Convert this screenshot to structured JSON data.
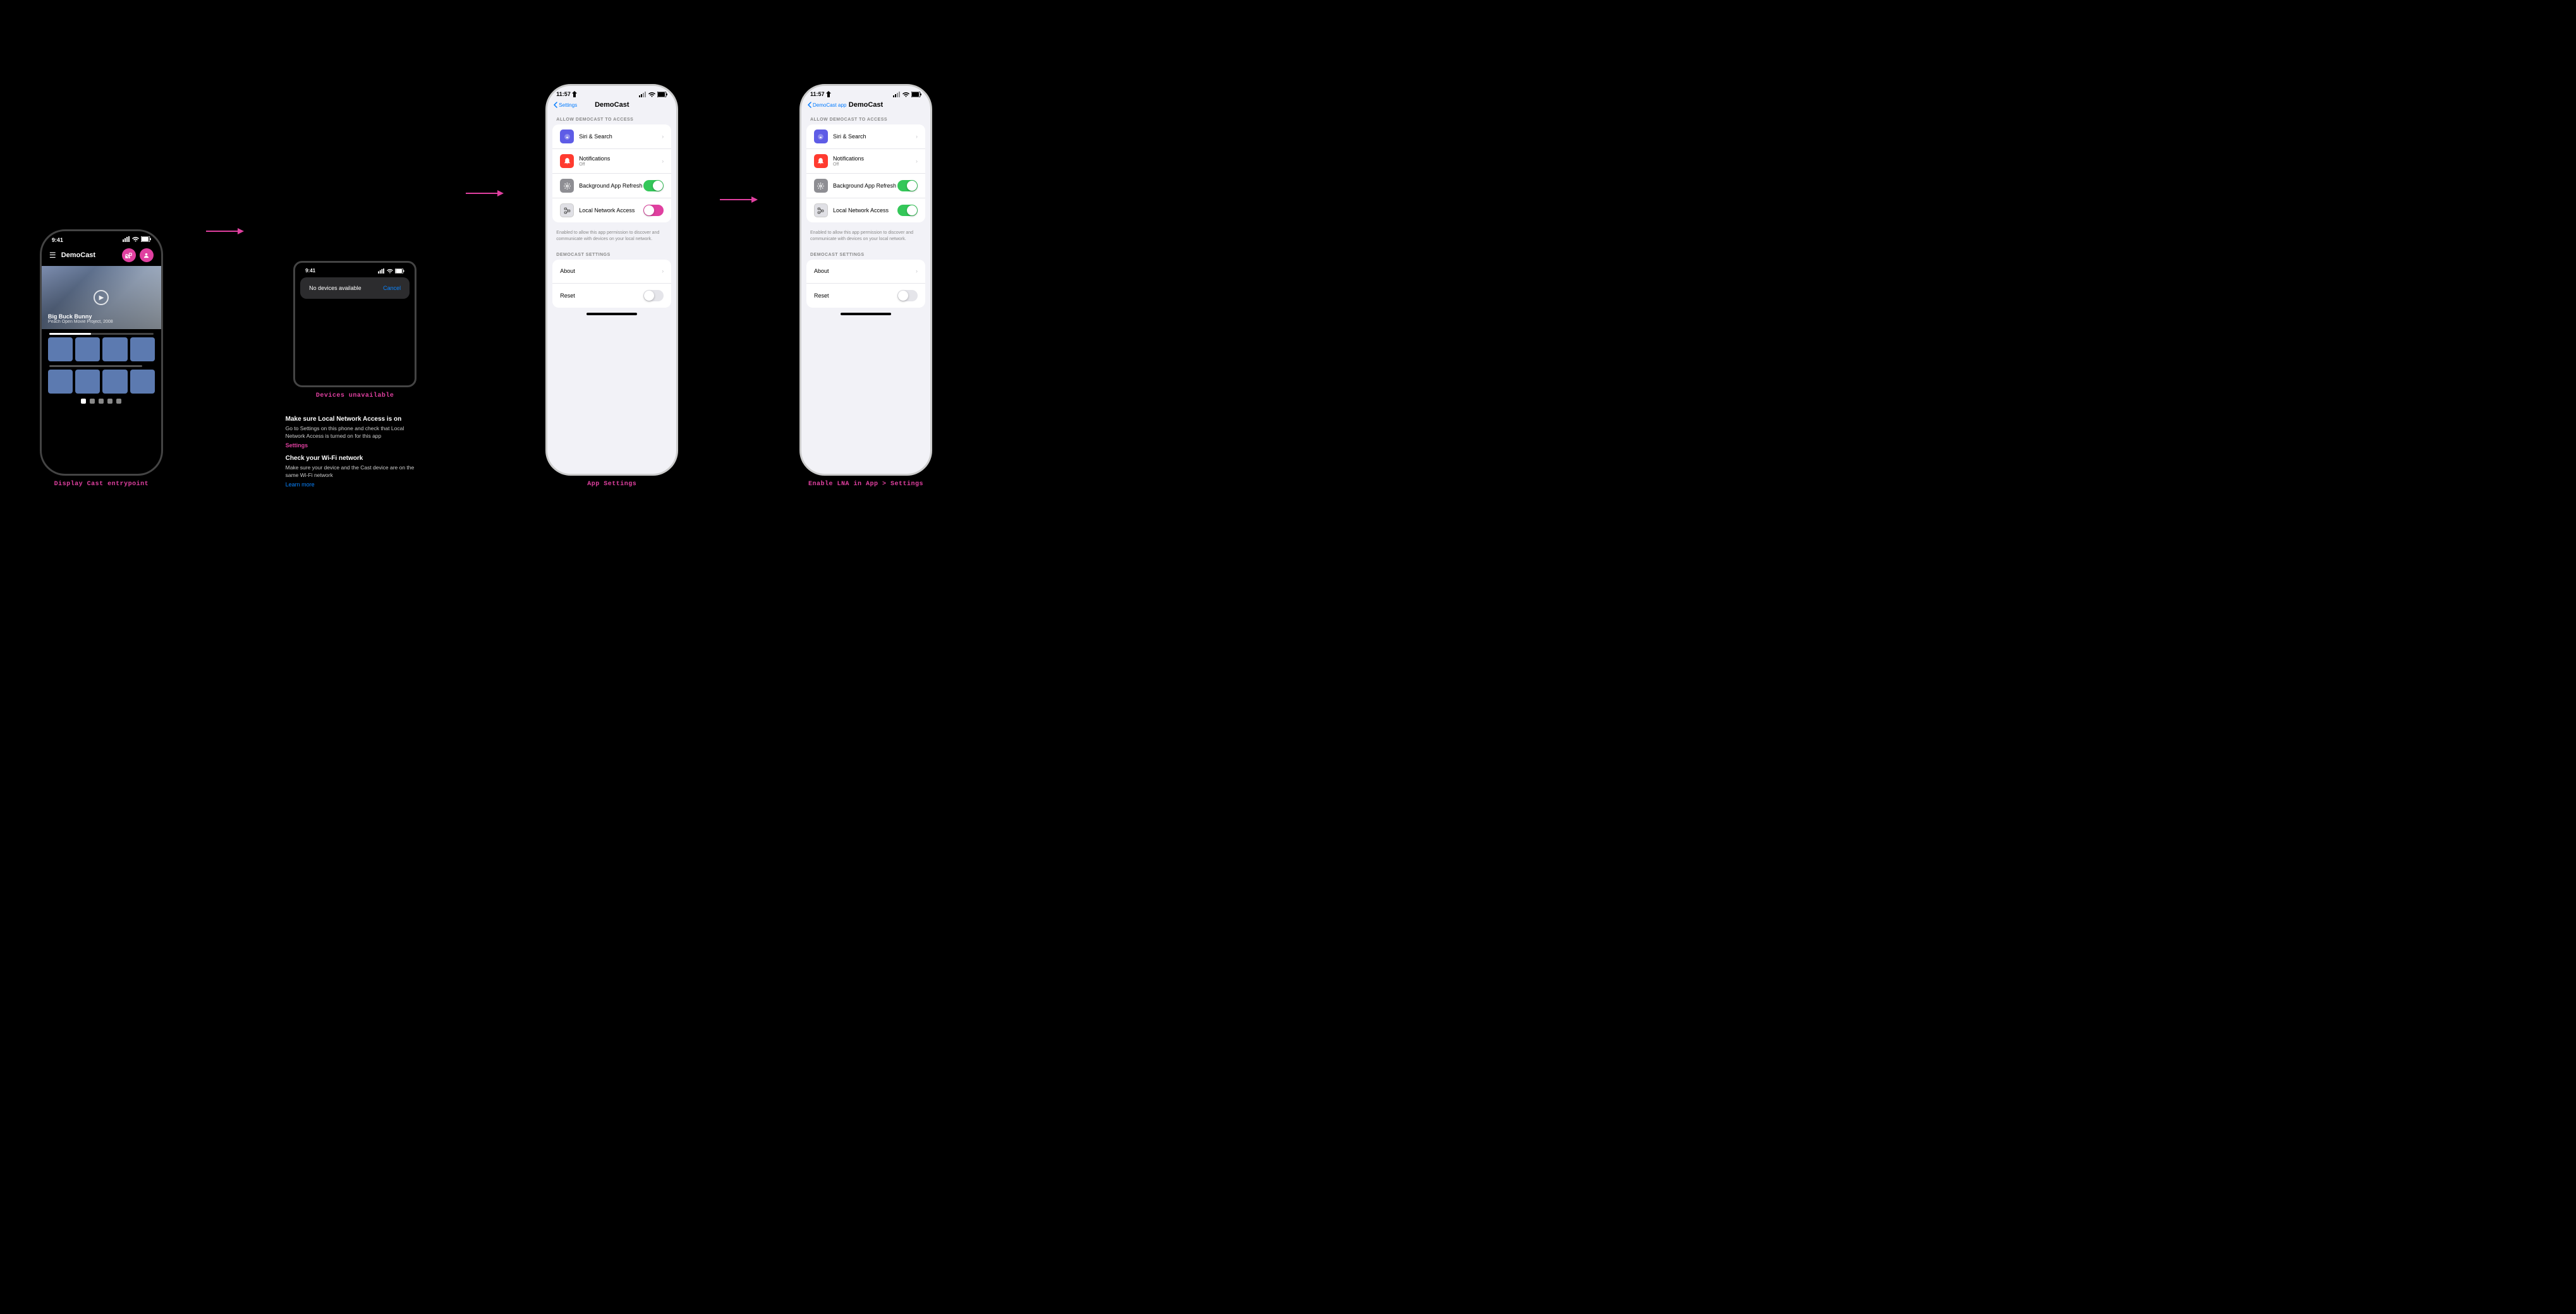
{
  "scene": {
    "background": "#000000"
  },
  "phone1": {
    "time": "9:41",
    "app_title": "DemoCast",
    "hero_title": "Big Buck Bunny",
    "hero_sub": "Peach Open Movie Project, 2008",
    "caption": "Display Cast entrypoint"
  },
  "phone2": {
    "time": "9:41",
    "dialog_title": "No devices available",
    "dialog_cancel": "Cancel",
    "caption": "Devices unavailable"
  },
  "instructions": {
    "heading1": "Make sure Local Network Access is on",
    "body1": "Go to Settings on this phone and check that Local Network Access is turned on for this app",
    "link1": "Settings",
    "heading2": "Check your Wi-Fi network",
    "body2": "Make sure your device and the Cast device are on the same Wi-Fi network",
    "link2": "Learn more"
  },
  "phone3": {
    "time": "11:57",
    "back_label": "Settings",
    "title": "DemoCast",
    "section_allow": "Allow DemoCast to Access",
    "row1_title": "Siri & Search",
    "row2_title": "Notifications",
    "row2_sub": "Off",
    "row3_title": "Background App Refresh",
    "row4_title": "Local Network Access",
    "hint": "Enabled to allow this app permission to discover and communicate with devices on your local network.",
    "section_settings": "DemoCast Settings",
    "row5_title": "About",
    "row6_title": "Reset",
    "caption": "App Settings"
  },
  "phone4": {
    "time": "11:57",
    "back_label": "DemoCast app",
    "title": "DemoCast",
    "section_allow": "Allow DemoCast to Access",
    "row1_title": "Siri & Search",
    "row2_title": "Notifications",
    "row2_sub": "Off",
    "row3_title": "Background App Refresh",
    "row4_title": "Local Network Access",
    "hint": "Enabled to allow this app permission to discover and communicate with devices on your local network.",
    "section_settings": "DemoCast Settings",
    "row5_title": "About",
    "row6_title": "Reset",
    "caption": "Enable LNA in App > Settings"
  }
}
